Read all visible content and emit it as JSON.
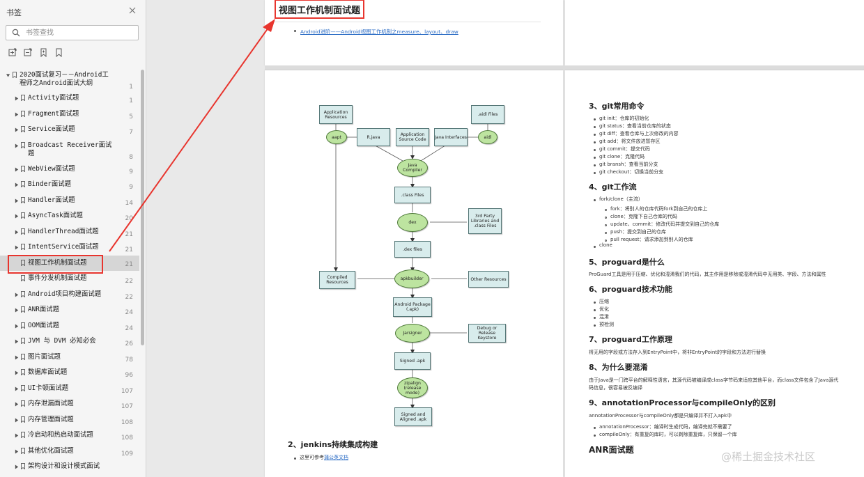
{
  "sidebar": {
    "title": "书签",
    "search_placeholder": "书签查找",
    "tree": [
      {
        "label": "2020面试复习－－Android工",
        "label2": "程师之Android面试大纲",
        "page": "1",
        "expanded": true
      },
      {
        "label": "Activity面试题",
        "page": "1"
      },
      {
        "label": "Fragment面试题",
        "page": "5"
      },
      {
        "label": "Service面试题",
        "page": "7"
      },
      {
        "label": "Broadcast Receiver面试",
        "label2": "题",
        "page": "8"
      },
      {
        "label": "WebView面试题",
        "page": "9"
      },
      {
        "label": "Binder面试题",
        "page": "9"
      },
      {
        "label": "Handler面试题",
        "page": "14"
      },
      {
        "label": "AsyncTask面试题",
        "page": "20"
      },
      {
        "label": "HandlerThread面试题",
        "page": "21"
      },
      {
        "label": "IntentService面试题",
        "page": "21"
      },
      {
        "label": "视图工作机制面试题",
        "page": "21",
        "selected": true,
        "leaf": true
      },
      {
        "label": "事件分发机制面试题",
        "page": "22",
        "leaf": true
      },
      {
        "label": "Android项目构建面试题",
        "page": "22"
      },
      {
        "label": "ANR面试题",
        "page": "24"
      },
      {
        "label": "OOM面试题",
        "page": "24"
      },
      {
        "label": "JVM 与 DVM 必知必会",
        "page": "26"
      },
      {
        "label": "图片面试题",
        "page": "78"
      },
      {
        "label": "数据库面试题",
        "page": "96"
      },
      {
        "label": "UI卡顿面试题",
        "page": "107"
      },
      {
        "label": "内存泄漏面试题",
        "page": "107"
      },
      {
        "label": "内存管理面试题",
        "page": "108"
      },
      {
        "label": "冷启动和热启动面试题",
        "page": "108"
      },
      {
        "label": "其他优化面试题",
        "page": "109"
      },
      {
        "label": "架构设计和设计模式面试",
        "page": ""
      }
    ]
  },
  "document": {
    "page1": {
      "title": "视图工作机制面试题",
      "link": "Android进阶——Android视图工作机制之measure、layout、draw"
    },
    "flowchart": {
      "app_resources": "Application Resources",
      "aidl_files": ".aidl Files",
      "aapt": "aapt",
      "r_java": "R.java",
      "app_source": "Application Source Code",
      "java_interfaces": "Java Interfaces",
      "aidl": "aidl",
      "java_compiler": "Java Compiler",
      "class_files": ".class Files",
      "dex": "dex",
      "third_party": "3rd Party Libraries and .class Files",
      "dex_files": ".dex files",
      "compiled_resources": "Compiled Resources",
      "apkbuilder": "apkbuilder",
      "other_resources": "Other Resources",
      "android_package": "Android Package (.apk)",
      "jarsigner": "Jarsigner",
      "keystore": "Debug or Release Keystore",
      "signed_apk": "Signed .apk",
      "zipalign": "zipalign (release mode)",
      "signed_aligned": "Signed and Aligned .apk"
    },
    "left_bottom": {
      "heading": "2、jenkins持续集成构建",
      "item_prefix": "这里可参考",
      "item_link": "蒲公英文档"
    },
    "right": {
      "h_git_cmd": "3、git常用命令",
      "git_cmds": [
        "git init：仓库的初始化",
        "git status：查看当前仓库的状态",
        "git diff：查看仓库与上次修改的内容",
        "git add：将文件放进暂存区",
        "git commit：提交代码",
        "git clone：克隆代码",
        "git bransh：查看当前分支",
        "git checkout：切换当前分支"
      ],
      "h_git_flow": "4、git工作流",
      "flow_top": "fork/clone（主流）",
      "flow_sub": [
        "fork：将别人的仓库代码fork到自己的仓库上",
        "clone：克隆下自己仓库的代码",
        "update、commit：修改代码并提交到自己的仓库",
        "push：提交到自己的仓库",
        "pull request：请求添加到别人的仓库"
      ],
      "flow_clone": "clone",
      "h_proguard": "5、proguard是什么",
      "p_proguard": "ProGuard工具是用于压缩、优化和混淆我们的代码，其主作用是移除或混淆代码中无用类、字段、方法和属性",
      "h_proguard_fn": "6、proguard技术功能",
      "proguard_fns": [
        "压缩",
        "优化",
        "混淆",
        "预检测"
      ],
      "h_proguard_principle": "7、proguard工作原理",
      "p_principle": "将无用的字段或方法存入到EntryPoint中，将非EntryPoint的字段和方法进行替换",
      "h_why": "8、为什么要混淆",
      "p_why1": "由于Java是一门跨平台的解释性语言，其源代码被编译成class字节码来适应其他平台，而class文件包含了Java源代",
      "p_why2": "码信息，很容易被反编译",
      "h_ap": "9、annotationProcessor与compileOnly的区别",
      "p_ap": "annotationProcessor与compileOnly都是只编译并不打入apk中",
      "ap_items": [
        "annotationProcessor：编译时生成代码，编译完就不需要了",
        "compileOnly：有重复的库时，可以剃除重复库，只保留一个库"
      ],
      "h_anr": "ANR面试题"
    },
    "watermark": "@稀土掘金技术社区"
  },
  "colors": {
    "highlight_red": "#e8352e",
    "link_blue": "#2a6bc4",
    "box_fill": "#d8ecec",
    "oval_fill": "#bde4a0"
  }
}
